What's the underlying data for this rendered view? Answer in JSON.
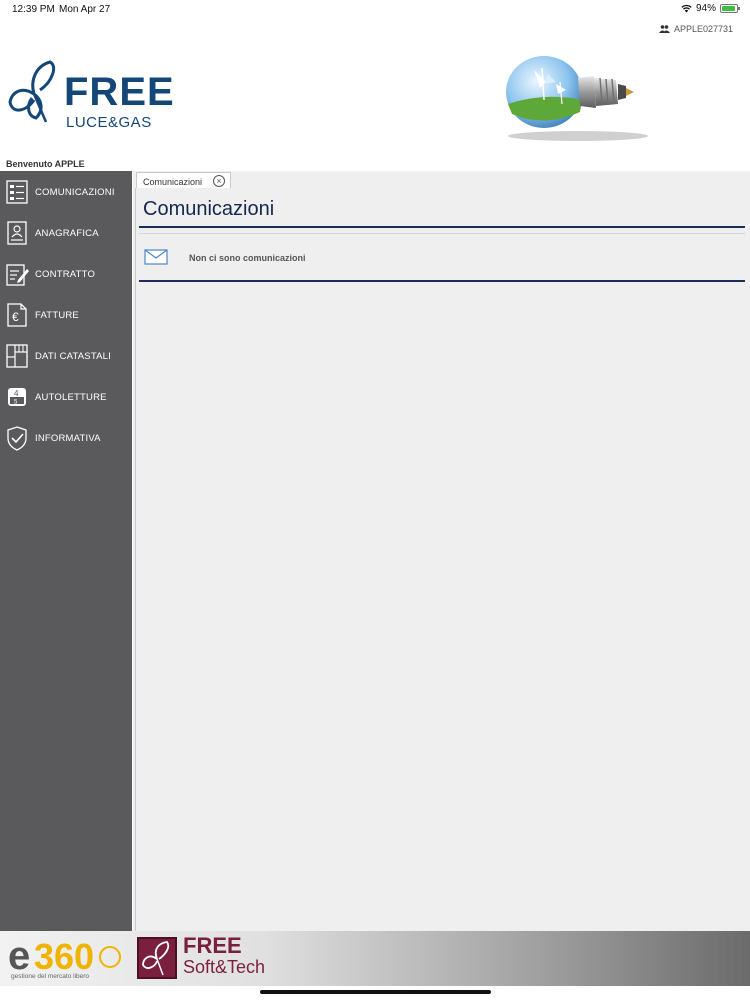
{
  "status_bar": {
    "time": "12:39 PM",
    "date": "Mon Apr 27",
    "battery_percent": "94%",
    "battery_level": 0.94,
    "icons": [
      "wifi-icon",
      "battery-icon"
    ]
  },
  "header": {
    "user_id": "APPLE027731",
    "logo_brand": "FREE",
    "logo_sub": "LUCE&GAS",
    "welcome": "Benvenuto APPLE"
  },
  "sidebar": {
    "items": [
      {
        "label": "COMUNICAZIONI",
        "icon": "document-list-icon"
      },
      {
        "label": "ANAGRAFICA",
        "icon": "id-card-icon"
      },
      {
        "label": "CONTRATTO",
        "icon": "contract-edit-icon"
      },
      {
        "label": "FATTURE",
        "icon": "euro-invoice-icon"
      },
      {
        "label": "DATI CATASTALI",
        "icon": "cadastral-icon"
      },
      {
        "label": "AUTOLETTURE",
        "icon": "meter-reading-icon"
      },
      {
        "label": "INFORMATIVA",
        "icon": "shield-check-icon"
      }
    ]
  },
  "main": {
    "tabs": [
      {
        "label": "Comunicazioni"
      }
    ],
    "title": "Comunicazioni",
    "empty_message": "Non ci sono comunicazioni"
  },
  "footer": {
    "e360_text": "e360",
    "e360_tagline": "gestione del mercato libero",
    "fst_title": "FREE",
    "fst_sub": "Soft&Tech"
  },
  "colors": {
    "brand_blue": "#134777",
    "sidebar_bg": "#5a5a5c",
    "title_navy": "#14284e",
    "fst_maroon": "#7a1f3d"
  }
}
